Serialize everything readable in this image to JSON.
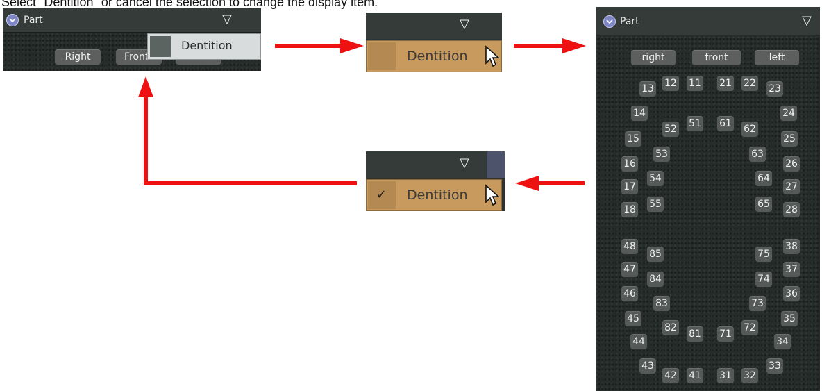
{
  "caption": "Select \"Dentition\" or cancel the selection to change the display item.",
  "colors": {
    "arrow": "#ee1111",
    "menu_highlight": "#c89a5e",
    "panel": "#2c3230"
  },
  "panel_small": {
    "title": "Part",
    "buttons": [
      "Right",
      "Front"
    ],
    "dropdown_item": "Dentition"
  },
  "menu_step2": {
    "item": "Dentition"
  },
  "menu_step3": {
    "item": "Dentition",
    "check": "✓"
  },
  "panel_large": {
    "title": "Part",
    "view_buttons": [
      "right",
      "front",
      "left"
    ],
    "teeth": [
      "13",
      "12",
      "11",
      "21",
      "22",
      "23",
      "14",
      "24",
      "52",
      "51",
      "61",
      "62",
      "15",
      "25",
      "53",
      "63",
      "16",
      "26",
      "54",
      "64",
      "17",
      "27",
      "55",
      "65",
      "18",
      "28",
      "48",
      "38",
      "85",
      "75",
      "47",
      "37",
      "84",
      "74",
      "46",
      "36",
      "83",
      "73",
      "45",
      "35",
      "82",
      "81",
      "71",
      "72",
      "44",
      "34",
      "43",
      "33",
      "42",
      "41",
      "31",
      "32"
    ]
  },
  "icons": [
    "circle-chevron-icon",
    "triangle-down-icon",
    "mouse-cursor-icon",
    "checkmark-icon"
  ]
}
